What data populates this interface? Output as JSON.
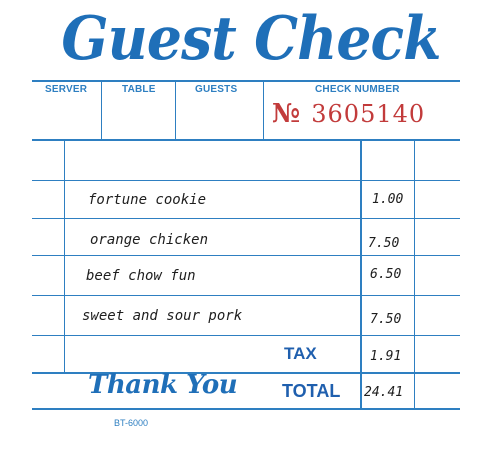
{
  "header": {
    "title": "Guest Check",
    "labels": {
      "server": "SERVER",
      "table": "TABLE",
      "guests": "GUESTS",
      "check_number": "CHECK NUMBER"
    },
    "check_no_symbol": "№",
    "check_number_value": "3605140"
  },
  "items": [
    {
      "name": "fortune cookie",
      "price": "1.00"
    },
    {
      "name": "orange chicken",
      "price": "7.50"
    },
    {
      "name": "beef chow fun",
      "price": "6.50"
    },
    {
      "name": "sweet and sour pork",
      "price": "7.50"
    }
  ],
  "totals": {
    "tax_label": "TAX",
    "tax_value": "1.91",
    "total_label": "TOTAL",
    "total_value": "24.41"
  },
  "footer": {
    "thank_you": "Thank You",
    "form_code": "BT-6000"
  },
  "colors": {
    "ink_blue": "#1f6fb8",
    "line_blue": "#2e7fc1",
    "check_red": "#c23b3b"
  }
}
